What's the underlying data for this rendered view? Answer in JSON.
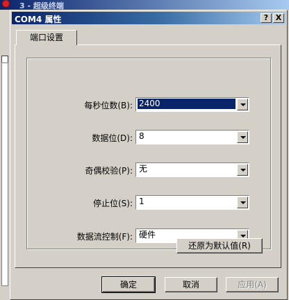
{
  "background_window": {
    "title": "3 - 超级终端"
  },
  "dialog": {
    "title": "COM4 属性",
    "help_label": "?",
    "close_label": "X",
    "tab_label": "端口设置",
    "fields": [
      {
        "label": "每秒位数(B):",
        "value": "2400",
        "selected": true
      },
      {
        "label": "数据位(D):",
        "value": "8",
        "selected": false
      },
      {
        "label": "奇偶校验(P):",
        "value": "无",
        "selected": false
      },
      {
        "label": "停止位(S):",
        "value": "1",
        "selected": false
      },
      {
        "label": "数据流控制(F):",
        "value": "硬件",
        "selected": false
      }
    ],
    "restore_defaults_label": "还原为默认值(R)",
    "ok_label": "确定",
    "cancel_label": "取消",
    "apply_label": "应用(A)"
  },
  "colors": {
    "titlebar_start": "#0a246a",
    "titlebar_end": "#a6caf0",
    "face": "#d4d0c8",
    "selection": "#0a246a"
  }
}
